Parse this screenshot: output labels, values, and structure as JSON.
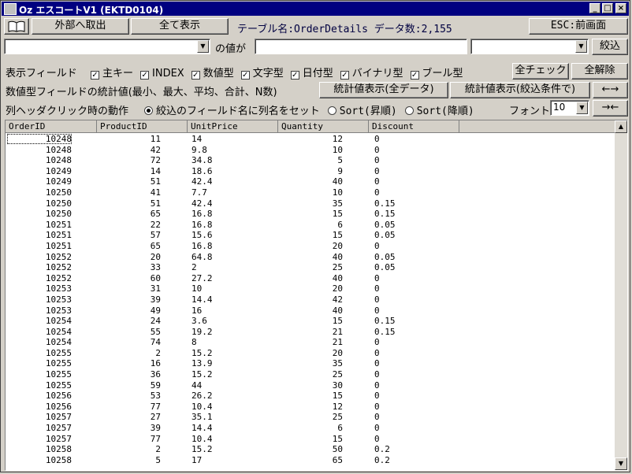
{
  "window": {
    "title": "Oz エスコートV1 (EKTD0104)",
    "minimize": "_",
    "maximize": "□",
    "close": "×"
  },
  "toolbar": {
    "export_label": "外部へ取出",
    "show_all_label": "全て表示",
    "table_info": "テーブル名:OrderDetails データ数:2,155",
    "esc_label": "ESC:前画面"
  },
  "filter": {
    "field_value": "",
    "of_value_label": "の値が",
    "condition_value": "",
    "operator_value": "",
    "narrow_label": "絞込"
  },
  "display_fields": {
    "label": "表示フィールド",
    "options": [
      {
        "label": "主キー",
        "checked": true
      },
      {
        "label": "INDEX",
        "checked": true
      },
      {
        "label": "数値型",
        "checked": true
      },
      {
        "label": "文字型",
        "checked": true
      },
      {
        "label": "日付型",
        "checked": true
      },
      {
        "label": "バイナリ型",
        "checked": true
      },
      {
        "label": "ブール型",
        "checked": true
      }
    ],
    "check_all_label": "全チェック",
    "uncheck_all_label": "全解除"
  },
  "stats": {
    "label": "数値型フィールドの統計値(最小、最大、平均、合計、N数)",
    "all_data_label": "統計値表示(全データ)",
    "filtered_label": "統計値表示(絞込条件で)",
    "expand_label": "←→"
  },
  "header_click": {
    "label": "列ヘッダクリック時の動作",
    "options": [
      {
        "label": "絞込のフィールド名に列名をセット",
        "selected": true
      },
      {
        "label": "Sort(昇順)",
        "selected": false
      },
      {
        "label": "Sort(降順)",
        "selected": false
      }
    ],
    "font_label": "フォント",
    "font_size": "10",
    "shrink_label": "→←"
  },
  "grid": {
    "columns": [
      "OrderID",
      "ProductID",
      "UnitPrice",
      "Quantity",
      "Discount"
    ],
    "rows": [
      [
        "10248",
        "11",
        "14",
        "12",
        "0"
      ],
      [
        "10248",
        "42",
        "9.8",
        "10",
        "0"
      ],
      [
        "10248",
        "72",
        "34.8",
        "5",
        "0"
      ],
      [
        "10249",
        "14",
        "18.6",
        "9",
        "0"
      ],
      [
        "10249",
        "51",
        "42.4",
        "40",
        "0"
      ],
      [
        "10250",
        "41",
        "7.7",
        "10",
        "0"
      ],
      [
        "10250",
        "51",
        "42.4",
        "35",
        "0.15"
      ],
      [
        "10250",
        "65",
        "16.8",
        "15",
        "0.15"
      ],
      [
        "10251",
        "22",
        "16.8",
        "6",
        "0.05"
      ],
      [
        "10251",
        "57",
        "15.6",
        "15",
        "0.05"
      ],
      [
        "10251",
        "65",
        "16.8",
        "20",
        "0"
      ],
      [
        "10252",
        "20",
        "64.8",
        "40",
        "0.05"
      ],
      [
        "10252",
        "33",
        "2",
        "25",
        "0.05"
      ],
      [
        "10252",
        "60",
        "27.2",
        "40",
        "0"
      ],
      [
        "10253",
        "31",
        "10",
        "20",
        "0"
      ],
      [
        "10253",
        "39",
        "14.4",
        "42",
        "0"
      ],
      [
        "10253",
        "49",
        "16",
        "40",
        "0"
      ],
      [
        "10254",
        "24",
        "3.6",
        "15",
        "0.15"
      ],
      [
        "10254",
        "55",
        "19.2",
        "21",
        "0.15"
      ],
      [
        "10254",
        "74",
        "8",
        "21",
        "0"
      ],
      [
        "10255",
        "2",
        "15.2",
        "20",
        "0"
      ],
      [
        "10255",
        "16",
        "13.9",
        "35",
        "0"
      ],
      [
        "10255",
        "36",
        "15.2",
        "25",
        "0"
      ],
      [
        "10255",
        "59",
        "44",
        "30",
        "0"
      ],
      [
        "10256",
        "53",
        "26.2",
        "15",
        "0"
      ],
      [
        "10256",
        "77",
        "10.4",
        "12",
        "0"
      ],
      [
        "10257",
        "27",
        "35.1",
        "25",
        "0"
      ],
      [
        "10257",
        "39",
        "14.4",
        "6",
        "0"
      ],
      [
        "10257",
        "77",
        "10.4",
        "15",
        "0"
      ],
      [
        "10258",
        "2",
        "15.2",
        "50",
        "0.2"
      ],
      [
        "10258",
        "5",
        "17",
        "65",
        "0.2"
      ]
    ]
  }
}
